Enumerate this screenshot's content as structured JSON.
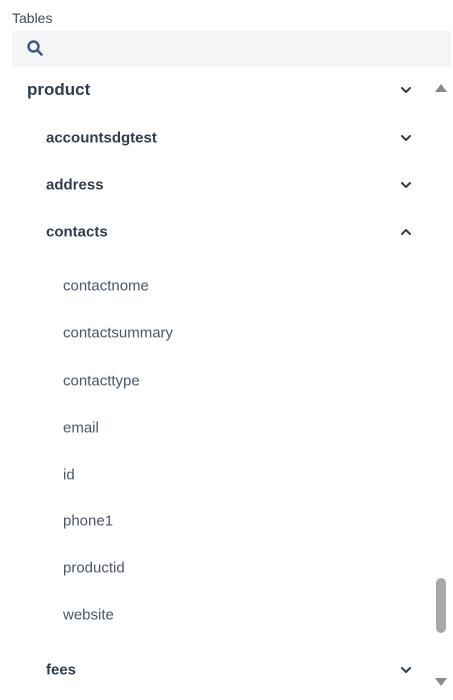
{
  "panel": {
    "title": "Tables",
    "search": {
      "placeholder": "",
      "value": ""
    }
  },
  "icons": {
    "search": "search-icon",
    "expand": "chevron-down-icon",
    "collapse": "chevron-up-icon"
  },
  "colors": {
    "text": "#2f3d4f",
    "search_bg": "#f3f5f7",
    "scroll_thumb": "#a8a8a8"
  },
  "tree": {
    "schema": {
      "label": "product",
      "expanded": true
    },
    "tables": [
      {
        "label": "accountsdgtest",
        "expanded": false
      },
      {
        "label": "address",
        "expanded": false
      },
      {
        "label": "contacts",
        "expanded": true,
        "columns": [
          "contactnome",
          "contactsummary",
          "contacttype",
          "email",
          "id",
          "phone1",
          "productid",
          "website"
        ]
      },
      {
        "label": "fees",
        "expanded": false
      }
    ]
  },
  "scrollbar": {
    "position": 0.86
  }
}
